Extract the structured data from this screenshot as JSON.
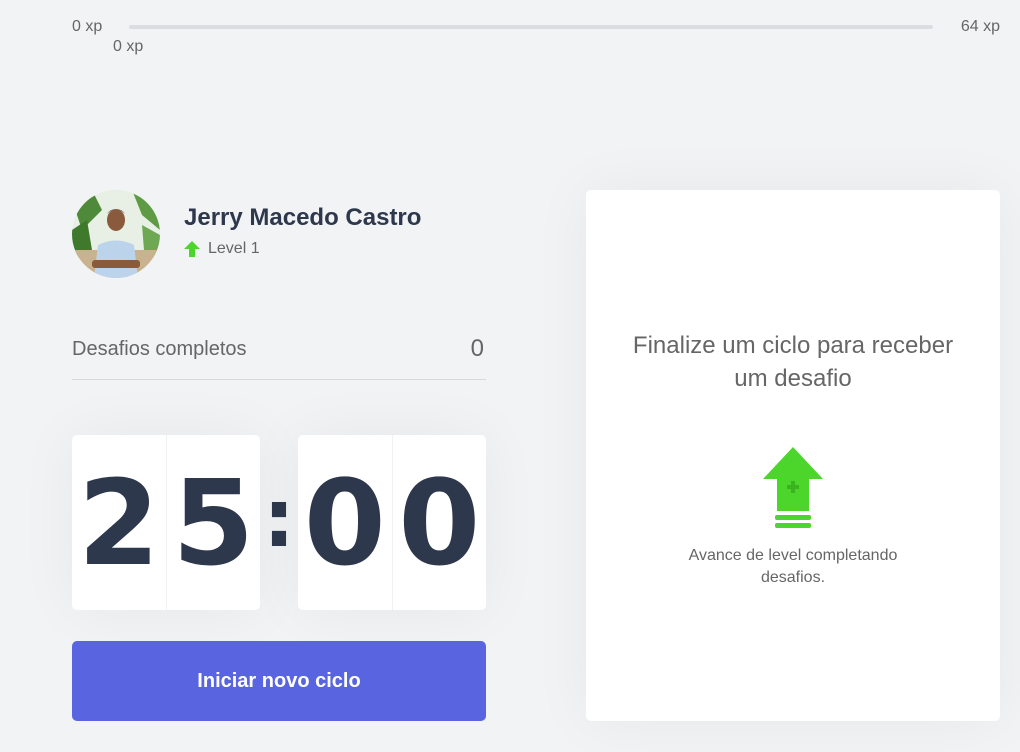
{
  "xp": {
    "min_label": "0 xp",
    "max_label": "64 xp",
    "current_label": "0 xp",
    "progress": 0,
    "accent_color": "#4cd62b"
  },
  "profile": {
    "name": "Jerry Macedo Castro",
    "level_label": "Level 1",
    "level_icon": "level-up-arrow-icon"
  },
  "completed": {
    "label": "Desafios completos",
    "count": "0"
  },
  "countdown": {
    "minute_left": "2",
    "minute_right": "5",
    "separator": ":",
    "second_left": "0",
    "second_right": "0"
  },
  "start_button": {
    "label": "Iniciar novo ciclo",
    "color": "#5965e0"
  },
  "challenge": {
    "title": "Finalize um ciclo para receber um desafio",
    "icon": "level-up-icon",
    "hint": "Avance de level completando desafios."
  }
}
